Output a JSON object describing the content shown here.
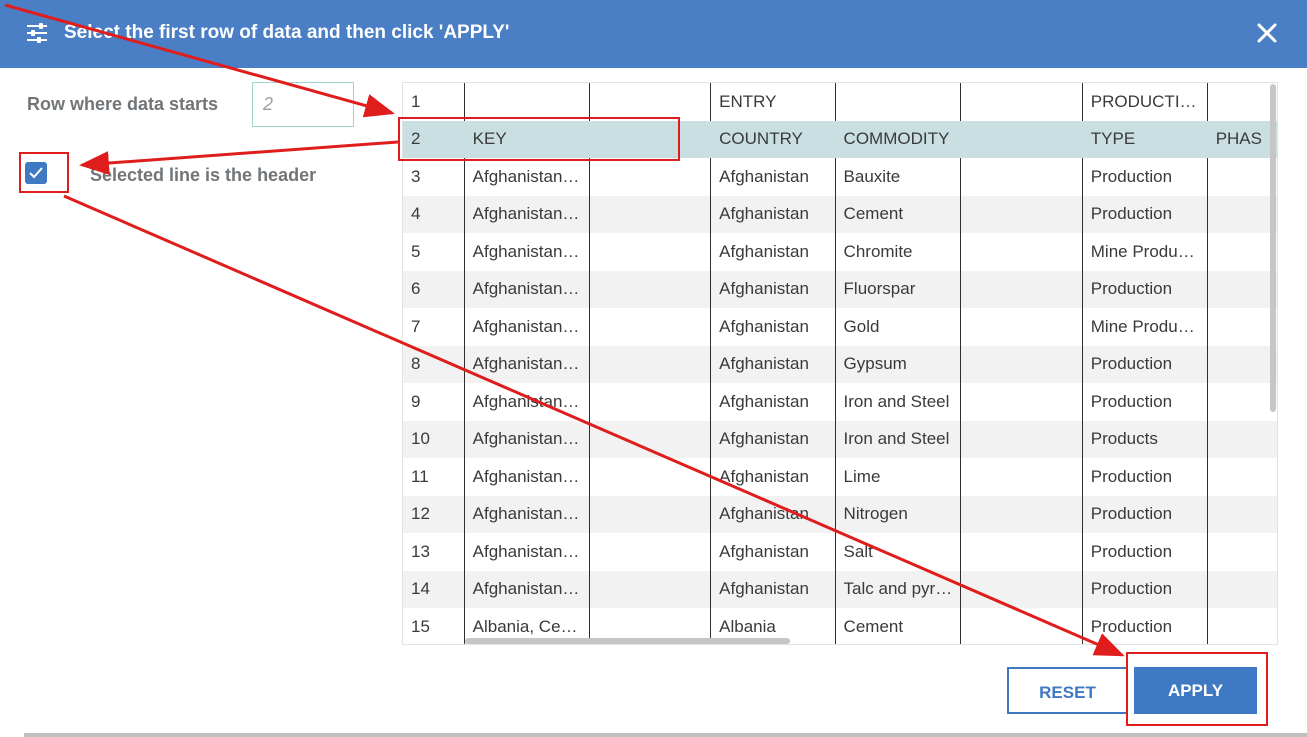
{
  "dialog": {
    "title": "Select the first row of data and then click 'APPLY'",
    "icon": "sliders-icon",
    "close_icon": "close-icon"
  },
  "settings": {
    "row_label": "Row where data starts",
    "row_value": "2",
    "header_checkbox_checked": true,
    "header_label": "Selected line is the header"
  },
  "grid": {
    "rows": [
      {
        "n": "1",
        "cells": [
          "",
          "",
          "ENTRY",
          "",
          "",
          "PRODUCTI…",
          ""
        ]
      },
      {
        "n": "2",
        "cells": [
          "KEY",
          "",
          "COUNTRY",
          "COMMODITY",
          "",
          "TYPE",
          "PHAS"
        ]
      },
      {
        "n": "3",
        "cells": [
          "Afghanistan…",
          "",
          "Afghanistan",
          "Bauxite",
          "",
          "Production",
          ""
        ]
      },
      {
        "n": "4",
        "cells": [
          "Afghanistan…",
          "",
          "Afghanistan",
          "Cement",
          "",
          "Production",
          ""
        ]
      },
      {
        "n": "5",
        "cells": [
          "Afghanistan…",
          "",
          "Afghanistan",
          "Chromite",
          "",
          "Mine Produ…",
          ""
        ]
      },
      {
        "n": "6",
        "cells": [
          "Afghanistan…",
          "",
          "Afghanistan",
          "Fluorspar",
          "",
          "Production",
          ""
        ]
      },
      {
        "n": "7",
        "cells": [
          "Afghanistan…",
          "",
          "Afghanistan",
          "Gold",
          "",
          "Mine Produ…",
          ""
        ]
      },
      {
        "n": "8",
        "cells": [
          "Afghanistan…",
          "",
          "Afghanistan",
          "Gypsum",
          "",
          "Production",
          ""
        ]
      },
      {
        "n": "9",
        "cells": [
          "Afghanistan…",
          "",
          "Afghanistan",
          "Iron and Steel",
          "",
          "Production",
          ""
        ]
      },
      {
        "n": "10",
        "cells": [
          "Afghanistan…",
          "",
          "Afghanistan",
          "Iron and Steel",
          "",
          "Products",
          ""
        ]
      },
      {
        "n": "11",
        "cells": [
          "Afghanistan…",
          "",
          "Afghanistan",
          "Lime",
          "",
          "Production",
          ""
        ]
      },
      {
        "n": "12",
        "cells": [
          "Afghanistan…",
          "",
          "Afghanistan",
          "Nitrogen",
          "",
          "Production",
          ""
        ]
      },
      {
        "n": "13",
        "cells": [
          "Afghanistan…",
          "",
          "Afghanistan",
          "Salt",
          "",
          "Production",
          ""
        ]
      },
      {
        "n": "14",
        "cells": [
          "Afghanistan…",
          "",
          "Afghanistan",
          "Talc and pyr…",
          "",
          "Production",
          ""
        ]
      },
      {
        "n": "15",
        "cells": [
          "Albania, Ce…",
          "",
          "Albania",
          "Cement",
          "",
          "Production",
          ""
        ]
      }
    ],
    "selected_row": "2"
  },
  "buttons": {
    "reset": "RESET",
    "apply": "APPLY"
  },
  "colors": {
    "header_bg": "#4a7ec5",
    "accent": "#3f78c3",
    "selected_row": "#cadfe2",
    "annotation": "#e01d1d"
  }
}
